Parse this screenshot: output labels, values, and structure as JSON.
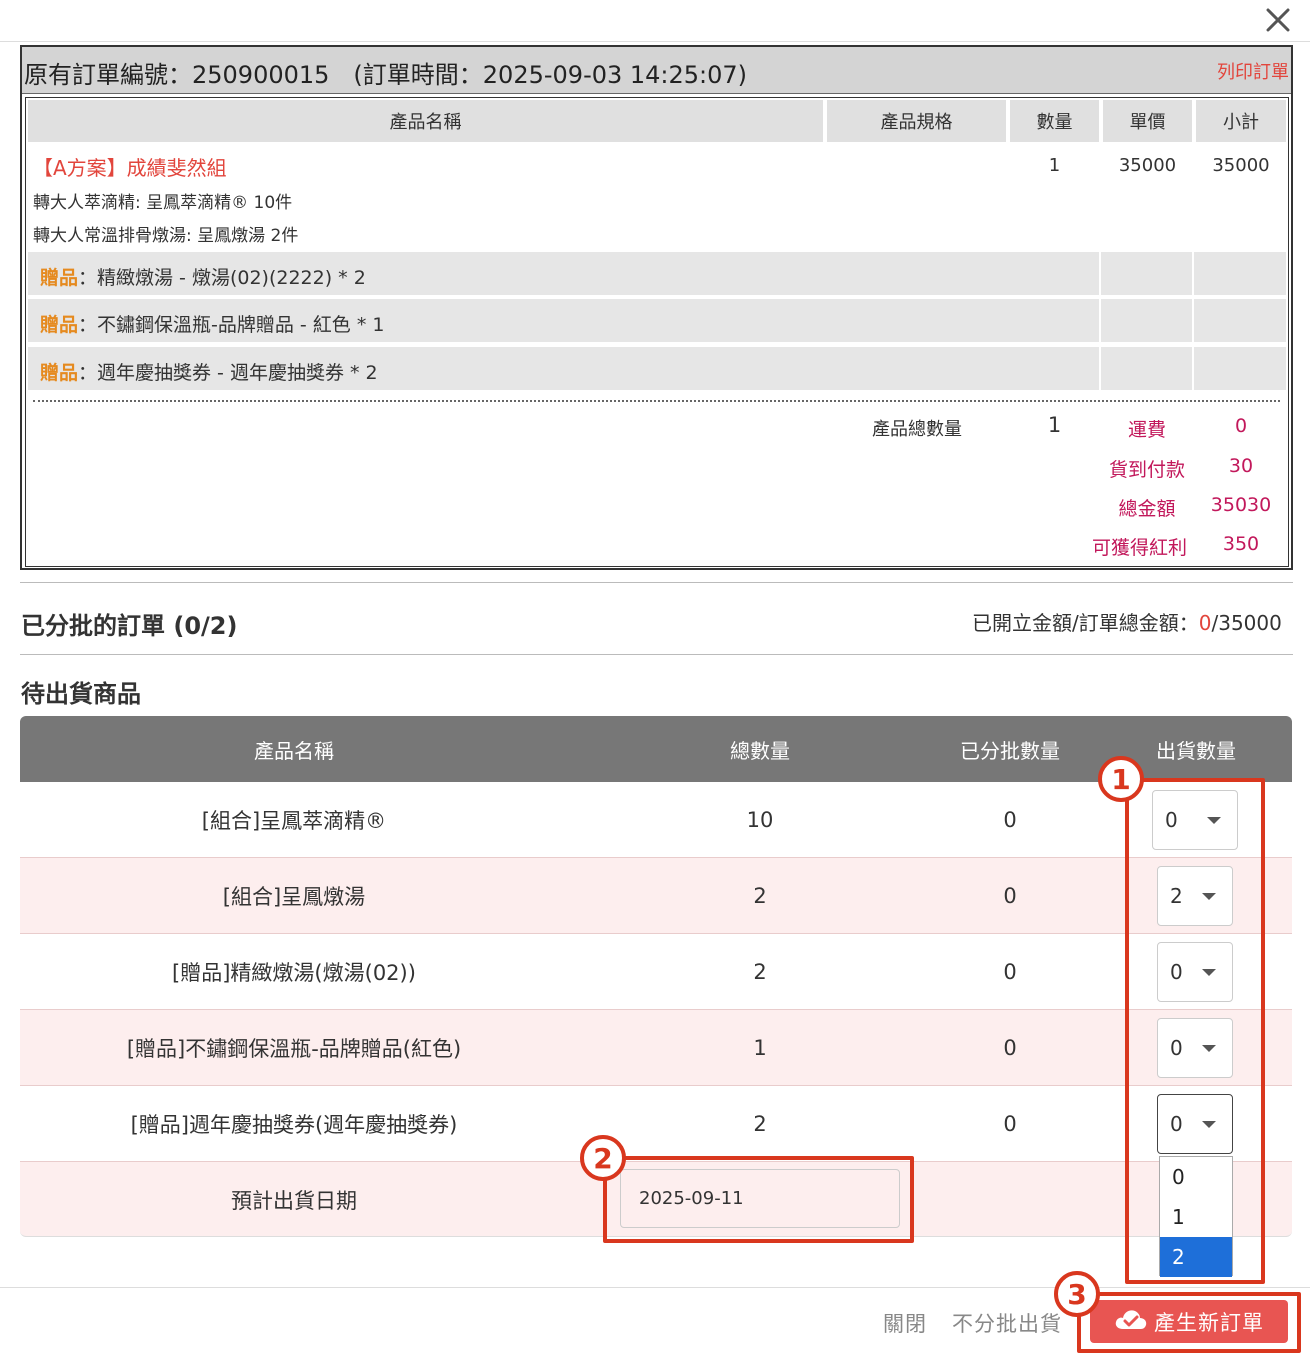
{
  "order": {
    "title": "原有訂單編號：250900015　(訂單時間：2025-09-03 14:25:07)",
    "print_link": "列印訂單",
    "columns": [
      "產品名稱",
      "產品規格",
      "數量",
      "單價",
      "小計"
    ],
    "main_product": {
      "name": "【A方案】成績斐然組",
      "details": [
        "轉大人萃滴精: 呈鳳萃滴精® 10件",
        "轉大人常溫排骨燉湯: 呈鳳燉湯 2件"
      ],
      "qty": "1",
      "price": "35000",
      "subtotal": "35000"
    },
    "gift_label": "贈品",
    "gifts": [
      "：精緻燉湯 - 燉湯(02)(2222) * 2",
      "：不鏽鋼保溫瓶-品牌贈品 - 紅色 * 1",
      "：週年慶抽獎券 - 週年慶抽獎券 * 2"
    ],
    "summary": {
      "total_qty_label": "產品總數量",
      "total_qty": "1",
      "rows": [
        {
          "label": "運費",
          "value": "0"
        },
        {
          "label": "貨到付款",
          "value": "30"
        },
        {
          "label": "總金額",
          "value": "35030"
        },
        {
          "label": "可獲得紅利",
          "value": "350"
        }
      ]
    }
  },
  "batched": {
    "title": "已分批的訂單 (0/2)",
    "amount_prefix": "已開立金額/訂單總金額：",
    "amount_opened": "0",
    "amount_total": "/35000"
  },
  "pending": {
    "title": "待出貨商品",
    "columns": [
      "產品名稱",
      "總數量",
      "已分批數量",
      "出貨數量"
    ],
    "rows": [
      {
        "name": "[組合]呈鳳萃滴精®",
        "total": "10",
        "batched": "0",
        "ship": "0"
      },
      {
        "name": "[組合]呈鳳燉湯",
        "total": "2",
        "batched": "0",
        "ship": "2"
      },
      {
        "name": "[贈品]精緻燉湯(燉湯(02))",
        "total": "2",
        "batched": "0",
        "ship": "0"
      },
      {
        "name": "[贈品]不鏽鋼保溫瓶-品牌贈品(紅色)",
        "total": "1",
        "batched": "0",
        "ship": "0"
      },
      {
        "name": "[贈品]週年慶抽獎券(週年慶抽獎券)",
        "total": "2",
        "batched": "0",
        "ship": "0"
      }
    ],
    "dropdown_options": [
      "0",
      "1",
      "2"
    ],
    "date_label": "預計出貨日期",
    "date_value": "2025-09-11"
  },
  "footer": {
    "close": "關閉",
    "no_batch": "不分批出貨",
    "create": "產生新訂單"
  },
  "badges": [
    "1",
    "2",
    "3"
  ],
  "colors": {
    "accent_red": "#e85552",
    "annotation_red": "#d9371e",
    "magenta": "#c2185b",
    "gift_orange": "#e58a1f",
    "selected_blue": "#1e6fd9"
  }
}
